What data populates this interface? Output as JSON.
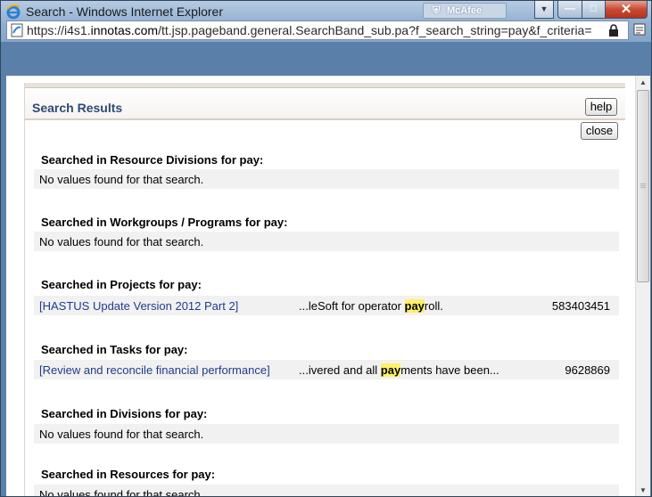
{
  "window": {
    "title": "Search - Windows Internet Explorer",
    "addon_badge": "McAfee",
    "url_prefix": "https://i4s1.",
    "url_domain": "innotas.com",
    "url_rest": "/tt.jsp.pageband.general.SearchBand_sub.pa?f_search_string=pay&f_criteria="
  },
  "panel": {
    "title": "Search Results",
    "help_label": "help",
    "close_label": "close"
  },
  "sections": [
    {
      "title": "Searched in Resource Divisions for pay:",
      "message": "No values found for that search."
    },
    {
      "title": "Searched in Workgroups / Programs for pay:",
      "message": "No values found for that search."
    },
    {
      "title": "Searched in Projects for pay:",
      "result": {
        "link": "[HASTUS Update Version 2012 Part 2]",
        "snippet_before": "...leSoft for operator ",
        "snippet_match": "pay",
        "snippet_after": "roll.",
        "id": "583403451"
      }
    },
    {
      "title": "Searched in Tasks for pay:",
      "result": {
        "link": "[Review and reconcile financial performance]",
        "snippet_before": "...ivered and all ",
        "snippet_match": "pay",
        "snippet_after": "ments have been...",
        "id": "9628869"
      }
    },
    {
      "title": "Searched in Divisions for pay:",
      "message": "No values found for that search."
    },
    {
      "title": "Searched in Resources for pay:",
      "message": "No values found for that search."
    }
  ],
  "colors": {
    "panel_title": "#2c4a77",
    "link": "#1f3c8a",
    "highlight": "#fff06a",
    "row_bg": "#f1f1f1"
  }
}
